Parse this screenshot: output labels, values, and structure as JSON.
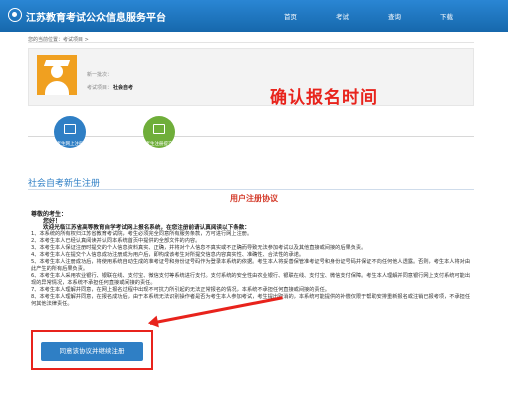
{
  "header": {
    "title": "江苏教育考试公众信息服务平台",
    "nav": [
      "首页",
      "考试",
      "查询",
      "下载"
    ]
  },
  "breadcrumb": "您的当前位置：考试项目 >",
  "profile": {
    "line1_label": "",
    "line2_label": "新一批次：",
    "line3_label": "考试项目：",
    "line3_value": "社会自考"
  },
  "annotation": "确认报名时间",
  "steps": [
    "考生网上注册",
    "考生注册提交"
  ],
  "section_title": "社会自考新生注册",
  "agreement_title": "用户注册协议",
  "greeting": "尊敬的考生：",
  "greeting2": "您好！",
  "welcome": "欢迎光临江苏省高等教育自学考试网上报名系统，在您注册前请认真阅读以下条款：",
  "clauses": [
    "1、本系统的所有权归江苏省教育考试院，考生必须完全同意所有服务条款，方可进行网上注册。",
    "2、本考生本人已经认真阅读并认同本系统首页中提供的全部文件的内容。",
    "3、本考生本人保证注册时提交的个人信息资料真实、正确，并将对个人信息不真实或不正确而导致无法参加考试以及其他直接或间接的后果负责。",
    "4、本考生本人在提交个人信息成功注册成为用户后，即构成该考生对所提交信息内容真实性、准确性、合法性的承诺。",
    "5、本考生本人注册成功后，将使用系统自动生成的准考证号和身份证号码作为登录本系统的依据。考生本人将妥善保管准考证号和身份证号码并保证不向任何他人透露。否则，考生本人将对由此产生的所有后果负责。",
    "6、本考生本人采用农业银行、银联在线、支付宝、微信支付等系统进行支付。支付系统的安全性由农业银行、银联在线、支付宝、微信支付保障。考生本人理解并同意银行网上支付系统可能出现的异常情况，本系统不承担任何直接或间接的责任。",
    "7、本考生本人理解并同意，在网上报名过程中出现不可抗力所引起的无法正常报名的情况，本系统不承担任何直接或间接的责任。",
    "8、本考生本人理解并同意，在报名成功后，由于本系统无法识别操作者是否为考生本人参加考试，考生提出取消的，本系统可能提供的补偿仅限于帮助安排重新报名或注销已报考项，不承担任何其他法律责任。"
  ],
  "button_label": "同意该协议并继续注册",
  "colors": {
    "header_bg": "#1a6fb5",
    "accent_blue": "#2f7fc5",
    "annotation_red": "#e8231c",
    "step1": "#2f7fc5",
    "step2": "#6fae3a",
    "avatar_bg": "#f0a020"
  }
}
